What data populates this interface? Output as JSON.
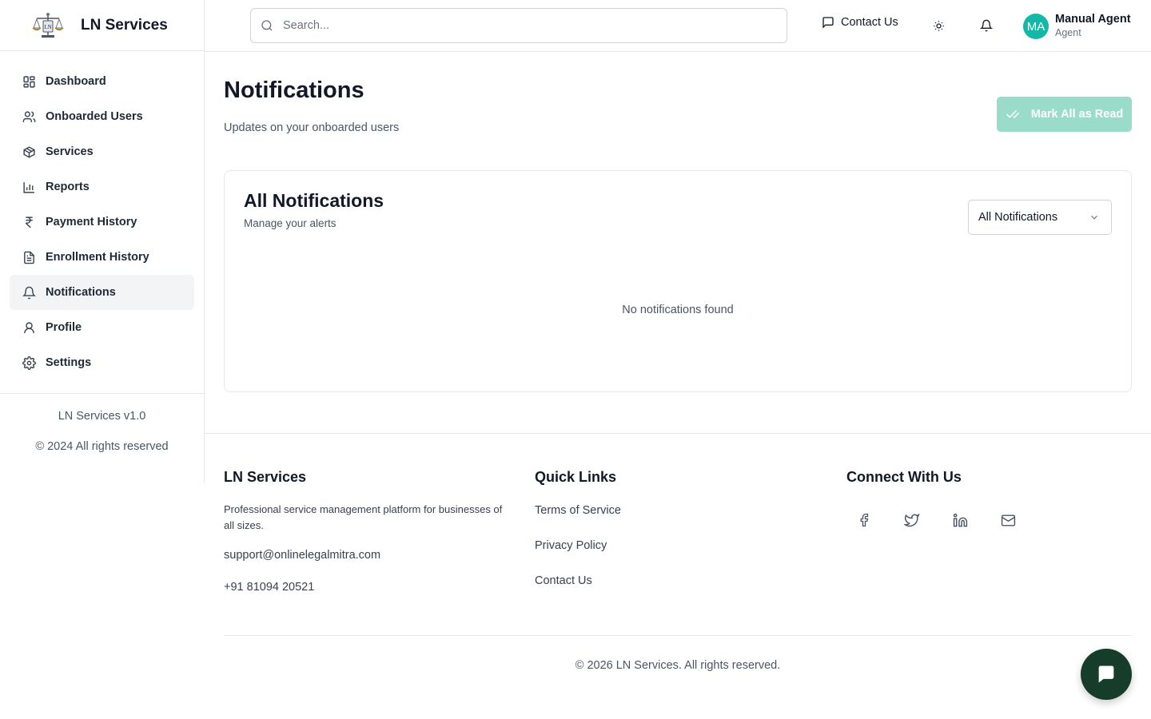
{
  "app": {
    "name": "LN Services"
  },
  "sidebar": {
    "items": [
      {
        "label": "Dashboard",
        "icon": "grid-icon"
      },
      {
        "label": "Onboarded Users",
        "icon": "users-icon"
      },
      {
        "label": "Services",
        "icon": "package-icon"
      },
      {
        "label": "Reports",
        "icon": "bar-chart-icon"
      },
      {
        "label": "Payment History",
        "icon": "rupee-icon"
      },
      {
        "label": "Enrollment History",
        "icon": "document-icon"
      },
      {
        "label": "Notifications",
        "icon": "bell-icon",
        "active": true
      },
      {
        "label": "Profile",
        "icon": "user-icon"
      },
      {
        "label": "Settings",
        "icon": "gear-icon"
      }
    ],
    "version": "LN Services v1.0",
    "copyright": "© 2024 All rights reserved"
  },
  "header": {
    "search_placeholder": "Search...",
    "contact_label": "Contact Us",
    "user": {
      "initials": "MA",
      "name": "Manual Agent",
      "role": "Agent"
    }
  },
  "main": {
    "title": "Notifications",
    "subtitle": "Updates on your onboarded users",
    "mark_all_label": "Mark All as Read",
    "card": {
      "title": "All Notifications",
      "subtitle": "Manage your alerts",
      "filter_value": "All Notifications",
      "empty_text": "No notifications found"
    }
  },
  "footer": {
    "brand_title": "LN Services",
    "description": "Professional service management platform for businesses of all sizes.",
    "email": "support@onlinelegalmitra.com",
    "phone": "+91 81094 20521",
    "quick_links_title": "Quick Links",
    "links": [
      "Terms of Service",
      "Privacy Policy",
      "Contact Us"
    ],
    "connect_title": "Connect With Us",
    "socials": [
      "facebook-icon",
      "twitter-icon",
      "linkedin-icon",
      "mail-icon"
    ],
    "copyright": "© 2026 LN Services. All rights reserved."
  },
  "colors": {
    "accent": "#14b8a6",
    "button_disabled": "#99dcc9",
    "chat_fab": "#163d2a"
  }
}
